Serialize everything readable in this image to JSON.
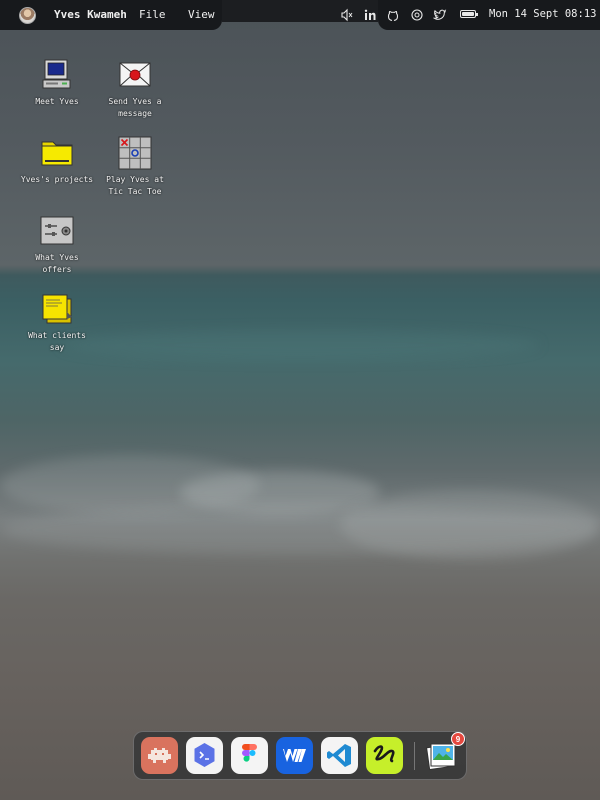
{
  "menubar": {
    "user_name": "Yves Kwameh",
    "menu_file": "File",
    "menu_view": "View",
    "datetime": "Mon 14 Sept 08:13",
    "tray_icons": [
      "volume-muted-icon",
      "linkedin-icon",
      "github-icon",
      "dribbble-icon",
      "twitter-icon",
      "battery-icon"
    ]
  },
  "desktop_icons": [
    {
      "label": "Meet Yves",
      "icon": "computer-icon"
    },
    {
      "label": "Send Yves a message",
      "icon": "mail-icon"
    },
    {
      "label": "Yves's projects",
      "icon": "folder-icon"
    },
    {
      "label": "Play Yves at Tic Tac Toe",
      "icon": "tic-tac-toe-icon"
    },
    {
      "label": "What Yves offers",
      "icon": "settings-panel-icon"
    },
    {
      "label": "What clients say",
      "icon": "sticky-notes-icon"
    }
  ],
  "dock": {
    "apps": [
      "retro-game-app-icon",
      "terminal-app-icon",
      "figma-app-icon",
      "webflow-app-icon",
      "vscode-app-icon",
      "zeplin-app-icon",
      "photos-app-icon"
    ],
    "photos_badge": "9"
  },
  "colors": {
    "menubar_bg": "#17191c",
    "badge": "#e5483f"
  }
}
